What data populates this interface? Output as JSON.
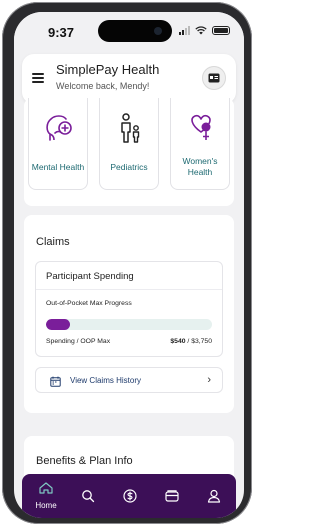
{
  "status_bar": {
    "time": "9:37"
  },
  "header": {
    "app_title": "SimplePay Health",
    "welcome": "Welcome back, Mendy!"
  },
  "services": [
    {
      "label": "Mental Health",
      "icon": "head-plus-icon"
    },
    {
      "label": "Pediatrics",
      "icon": "parent-child-icon"
    },
    {
      "label_line1": "Women's",
      "label_line2": "Health",
      "icon": "female-heart-icon"
    }
  ],
  "claims": {
    "title": "Claims",
    "participant_spending": {
      "title": "Participant Spending",
      "progress_label": "Out-of-Pocket Max Progress",
      "progress_fraction": 0.144,
      "spending_label": "Spending / OOP Max",
      "spent": "$540",
      "separator": " / ",
      "max": "$3,750"
    },
    "history_button": "View Claims History"
  },
  "benefits": {
    "title": "Benefits & Plan Info"
  },
  "tab_bar": {
    "home_label": "Home",
    "tabs": [
      "home-icon",
      "search-icon",
      "dollar-icon",
      "wallet-icon",
      "profile-icon"
    ]
  },
  "colors": {
    "accent": "#7a1e9a",
    "tabbar": "#3c0f57",
    "teal_text": "#1e6a72",
    "track": "#e6f1ef"
  }
}
